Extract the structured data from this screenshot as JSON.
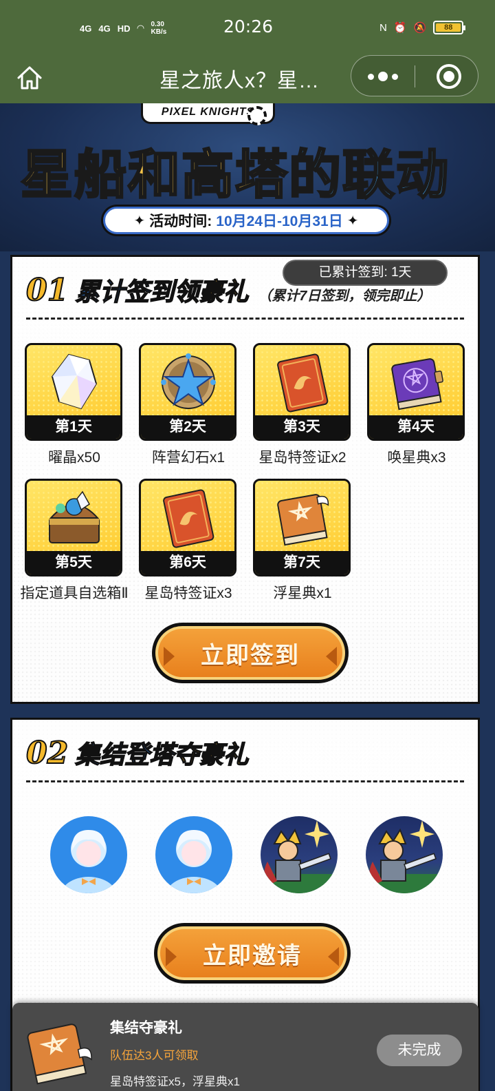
{
  "status_bar": {
    "network1": "4G",
    "network2": "4G",
    "hd": "HD",
    "speed": "0.30 KB/s",
    "time": "20:26",
    "battery": "88"
  },
  "nav": {
    "title": "星之旅人x？星…"
  },
  "banner": {
    "logo": "PIXEL KNIGHTS",
    "title_part1": "星船和高塔",
    "title_part2": "的联动",
    "date_label": "活动时间:",
    "date_value": "10月24日-10月31日"
  },
  "section1": {
    "num": "01",
    "title_part1": "累计签到",
    "title_part2": "领豪礼",
    "note": "（累计7日签到，领完即止）",
    "checkin_status": "已累计签到: 1天",
    "rewards": [
      {
        "day": "第1天",
        "label": "曜晶x50",
        "icon": "crystal-icon"
      },
      {
        "day": "第2天",
        "label": "阵营幻石x1",
        "icon": "star-stone-icon"
      },
      {
        "day": "第3天",
        "label": "星岛特签证x2",
        "icon": "visa-icon"
      },
      {
        "day": "第4天",
        "label": "唤星典x3",
        "icon": "purple-book-icon"
      },
      {
        "day": "第5天",
        "label": "指定道具自选箱Ⅱ",
        "icon": "chest-icon"
      },
      {
        "day": "第6天",
        "label": "星岛特签证x3",
        "icon": "visa-icon"
      },
      {
        "day": "第7天",
        "label": "浮星典x1",
        "icon": "orange-book-icon"
      }
    ],
    "button": "立即签到"
  },
  "section2": {
    "num": "02",
    "title_part1": "集结登塔",
    "title_part2": "夺豪礼",
    "button": "立即邀请"
  },
  "popup": {
    "title": "集结夺豪礼",
    "condition": "队伍达3人可领取",
    "rewards": "星岛特签证x5，浮星典x1",
    "status": "未完成"
  },
  "colors": {
    "bar": "#4e6a3c",
    "gold": "#f7c54a",
    "blue": "#3e9be6",
    "orange_button": "#e8801d"
  }
}
